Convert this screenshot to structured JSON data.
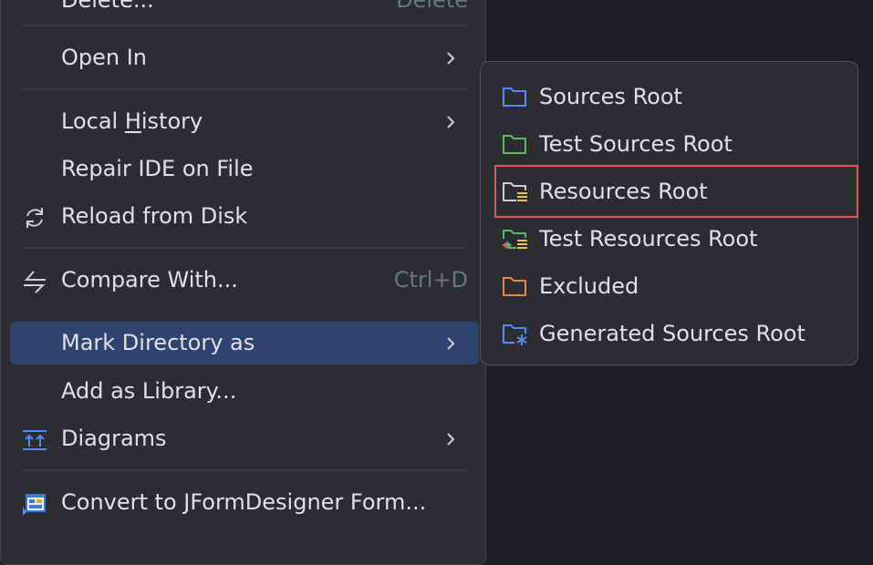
{
  "main_menu": {
    "items": [
      {
        "label": "Delete...",
        "shortcut": "Delete"
      },
      {
        "label": "Open In"
      },
      {
        "label": "Local History",
        "mnemonic": "H"
      },
      {
        "label": "Repair IDE on File"
      },
      {
        "label": "Reload from Disk"
      },
      {
        "label": "Compare With...",
        "shortcut": "Ctrl+D"
      },
      {
        "label": "Mark Directory as"
      },
      {
        "label": "Add as Library..."
      },
      {
        "label": "Diagrams"
      },
      {
        "label": "Convert to JFormDesigner Form..."
      }
    ]
  },
  "submenu": {
    "items": [
      {
        "label": "Sources Root",
        "icon": "folder-blue-icon",
        "color": "#548af7"
      },
      {
        "label": "Test Sources Root",
        "icon": "folder-green-icon",
        "color": "#5fb865"
      },
      {
        "label": "Resources Root",
        "icon": "resources-folder-icon",
        "color": "#ced0d6"
      },
      {
        "label": "Test Resources Root",
        "icon": "test-resources-folder-icon",
        "color": "#5fb865"
      },
      {
        "label": "Excluded",
        "icon": "folder-orange-icon",
        "color": "#e08855"
      },
      {
        "label": "Generated Sources Root",
        "icon": "generated-folder-icon",
        "color": "#548af7"
      }
    ],
    "highlighted": "Resources Root"
  },
  "colors": {
    "menu_bg": "#2b2d30",
    "selected_bg": "#2e436e",
    "highlight_border": "#e05555"
  }
}
